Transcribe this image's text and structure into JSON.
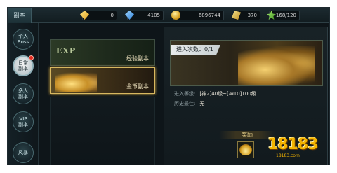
{
  "topbar": {
    "title": "副本",
    "resources": [
      {
        "icon": "yellow-diamond-icon",
        "value": "0"
      },
      {
        "icon": "blue-diamond-icon",
        "value": "4105"
      },
      {
        "icon": "gold-coin-icon",
        "value": "6896744"
      },
      {
        "icon": "crystal-icon",
        "value": "370"
      },
      {
        "icon": "stamina-icon",
        "value": "168/120"
      }
    ]
  },
  "sidebar": {
    "items": [
      {
        "label": "个人Boss",
        "active": false
      },
      {
        "label": "日常副本",
        "active": true,
        "badge": true
      },
      {
        "label": "多人副本",
        "active": false
      },
      {
        "label": "VIP副本",
        "active": false
      },
      {
        "label": "风暴",
        "active": false
      }
    ]
  },
  "dungeons": {
    "exp": {
      "logo": "EXP",
      "name": "经验副本"
    },
    "gold": {
      "name": "金币副本"
    }
  },
  "detail": {
    "enter_label": "进入次数：0/1",
    "level_label": "进入等级:",
    "level_value": "[神2]40级~[神10]100级",
    "best_label": "历史最佳:",
    "best_value": "无",
    "reward_title": "奖励"
  },
  "watermark": {
    "text": "18183",
    "sub": "18183.com"
  },
  "colors": {
    "accent_gold": "#f4b400",
    "badge_red": "#e02a20"
  }
}
